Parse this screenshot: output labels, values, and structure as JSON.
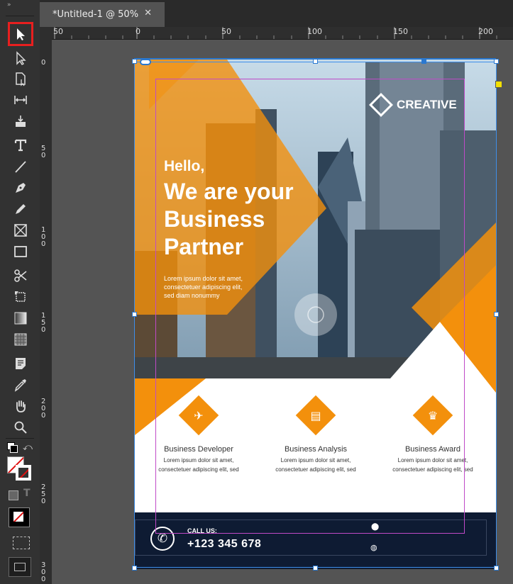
{
  "document_tab": {
    "title": "*Untitled-1 @ 50%",
    "close_glyph": "✕"
  },
  "toolbar": {
    "grip": "»",
    "tools": [
      "selection-tool",
      "direct-selection-tool",
      "page-tool",
      "gap-tool",
      "content-collector-tool",
      "type-tool",
      "line-tool",
      "pen-tool",
      "pencil-tool",
      "rectangle-frame-tool",
      "rectangle-tool",
      "scissors-tool",
      "free-transform-tool",
      "gradient-swatch-tool",
      "gradient-feather-tool",
      "note-tool",
      "eyedropper-tool",
      "hand-tool",
      "zoom-tool"
    ],
    "selected_tool": "selection-tool",
    "selected_color": "#e81f1f"
  },
  "ruler_h": [
    "50",
    "0",
    "50",
    "100",
    "150",
    "200"
  ],
  "ruler_v": [
    "0",
    "50",
    "100",
    "150",
    "200",
    "250",
    "300"
  ],
  "flyer": {
    "brand": "CREATIVE",
    "hello": "Hello,",
    "headline": [
      "We are your",
      "Business",
      "Partner"
    ],
    "body": [
      "Lorem ipsum dolor sit amet,",
      "consectetuer adipiscing elit,",
      "sed diam nonummy"
    ],
    "features": [
      {
        "name": "Business Developer",
        "desc": [
          "Lorem ipsum dolor sit amet,",
          "consectetuer adipiscing elit, sed"
        ],
        "icon": "paper-plane-icon"
      },
      {
        "name": "Business Analysis",
        "desc": [
          "Lorem ipsum dolor sit amet,",
          "consectetuer adipiscing elit, sed"
        ],
        "icon": "chart-icon"
      },
      {
        "name": "Business Award",
        "desc": [
          "Lorem ipsum dolor sit amet,",
          "consectetuer adipiscing elit, sed"
        ],
        "icon": "trophy-icon"
      }
    ],
    "call_label": "CALL US:",
    "phone": "+123 345 678"
  },
  "colors": {
    "accent": "#f3900c",
    "footer": "#0e1b33",
    "selection": "#2a78d0",
    "margin_guide": "#c04ac8"
  }
}
